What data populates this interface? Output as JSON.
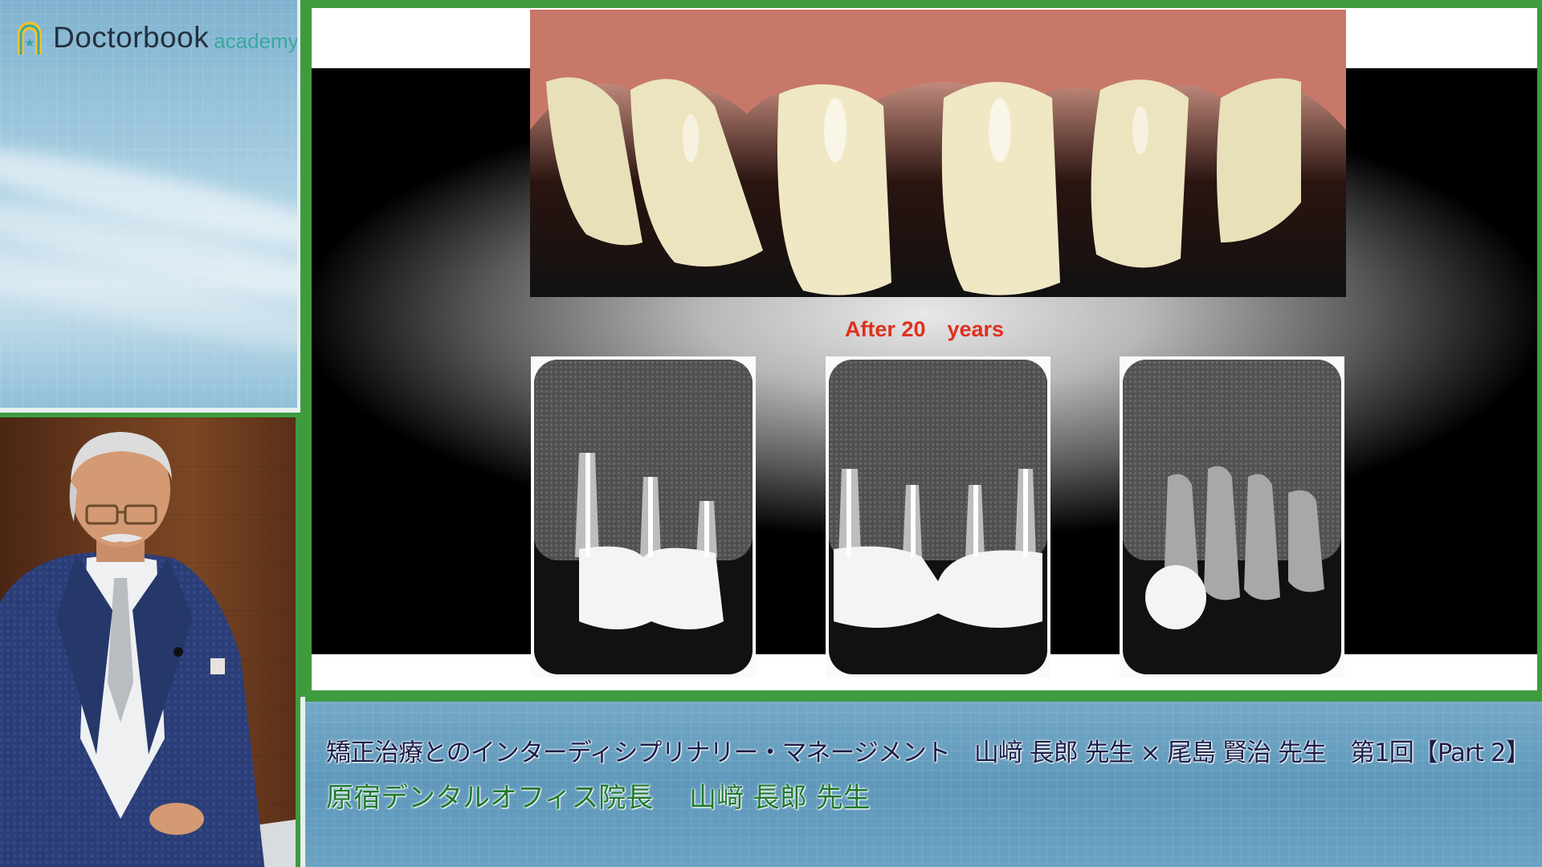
{
  "brand": {
    "name": "Doctorbook",
    "sub": "academy",
    "icon": "arch-star-icon",
    "accent_color": "#3aa8a0"
  },
  "slide": {
    "caption": "After 20　years",
    "caption_color": "#e0301e",
    "xray_count": 3
  },
  "lecture": {
    "title": "矯正治療とのインターディシプリナリー・マネージメント　山﨑 長郎 先生 × 尾島 賢治 先生　第1回【Part 2】",
    "lecturer": "原宿デンタルオフィス院長　 山﨑 長郎 先生",
    "title_color": "#1d1d4a",
    "lecturer_color": "#1f7a2e"
  },
  "theme": {
    "frame_green": "#3e9b3e"
  }
}
